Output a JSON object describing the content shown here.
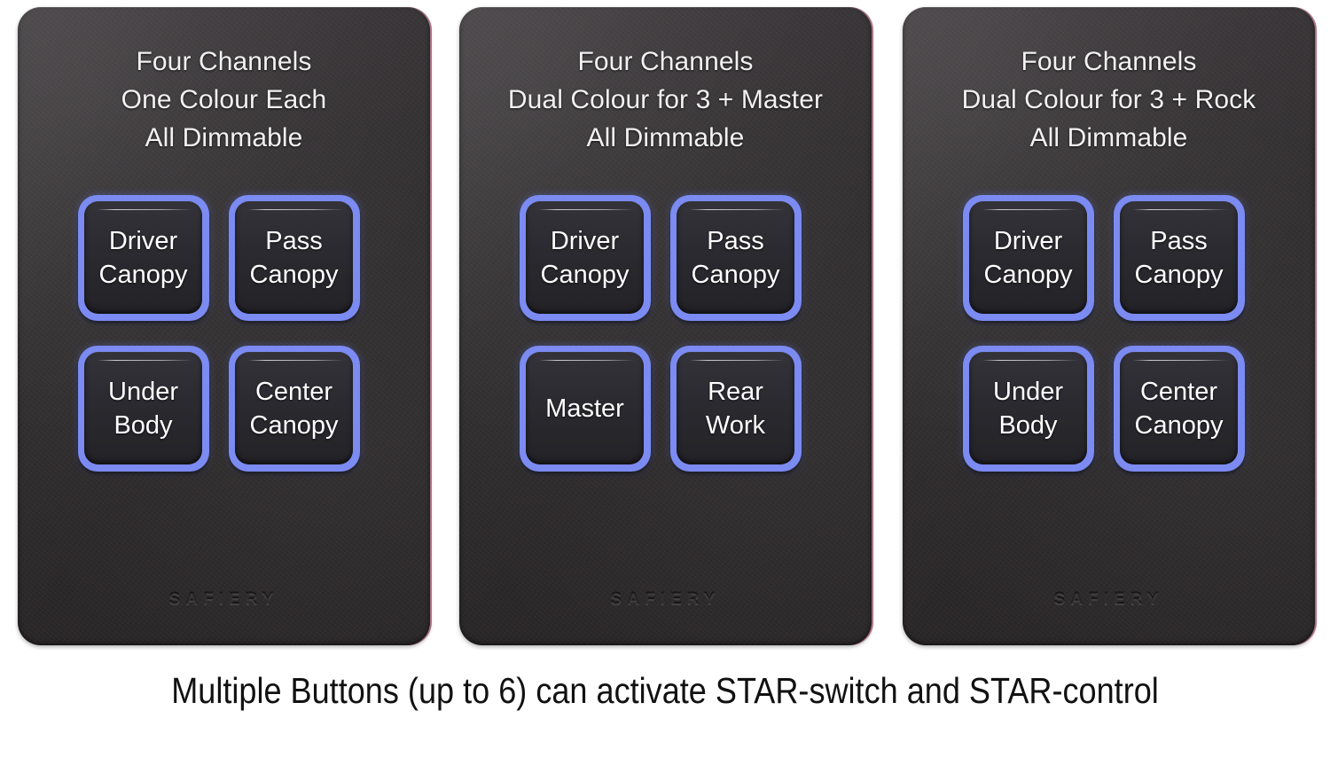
{
  "caption": "Multiple Buttons (up to 6) can activate STAR-switch and STAR-control",
  "brand": "SAFIERY",
  "colors": {
    "panel_body": "#2e2b2d",
    "button_glow": "#7b8bf2",
    "button_face": "#2c2b31",
    "label_text": "#ffffff",
    "header_text": "#f2f2f2",
    "caption_text": "#111111",
    "background": "#ffffff"
  },
  "panels": [
    {
      "id": "panel-one-colour-each",
      "header": {
        "line1": "Four Channels",
        "line2": "One Colour Each",
        "line3": "All Dimmable"
      },
      "brand": "SAFIERY",
      "buttons": [
        {
          "id": "driver-canopy",
          "line1": "Driver",
          "line2": "Canopy",
          "lit": true
        },
        {
          "id": "pass-canopy",
          "line1": "Pass",
          "line2": "Canopy",
          "lit": true
        },
        {
          "id": "under-body",
          "line1": "Under",
          "line2": "Body",
          "lit": true
        },
        {
          "id": "center-canopy",
          "line1": "Center",
          "line2": "Canopy",
          "lit": true
        }
      ]
    },
    {
      "id": "panel-dual-colour-master",
      "header": {
        "line1": "Four Channels",
        "line2": "Dual Colour for 3 + Master",
        "line3": "All Dimmable"
      },
      "brand": "SAFIERY",
      "buttons": [
        {
          "id": "driver-canopy",
          "line1": "Driver",
          "line2": "Canopy",
          "lit": true
        },
        {
          "id": "pass-canopy",
          "line1": "Pass",
          "line2": "Canopy",
          "lit": true
        },
        {
          "id": "master",
          "line1": "Master",
          "line2": "",
          "lit": true
        },
        {
          "id": "rear-work",
          "line1": "Rear",
          "line2": "Work",
          "lit": true
        }
      ]
    },
    {
      "id": "panel-dual-colour-rock",
      "header": {
        "line1": "Four Channels",
        "line2": "Dual Colour for 3 + Rock",
        "line3": "All Dimmable"
      },
      "brand": "SAFIERY",
      "buttons": [
        {
          "id": "driver-canopy",
          "line1": "Driver",
          "line2": "Canopy",
          "lit": true
        },
        {
          "id": "pass-canopy",
          "line1": "Pass",
          "line2": "Canopy",
          "lit": true
        },
        {
          "id": "under-body",
          "line1": "Under",
          "line2": "Body",
          "lit": true
        },
        {
          "id": "center-canopy",
          "line1": "Center",
          "line2": "Canopy",
          "lit": true
        }
      ]
    }
  ]
}
